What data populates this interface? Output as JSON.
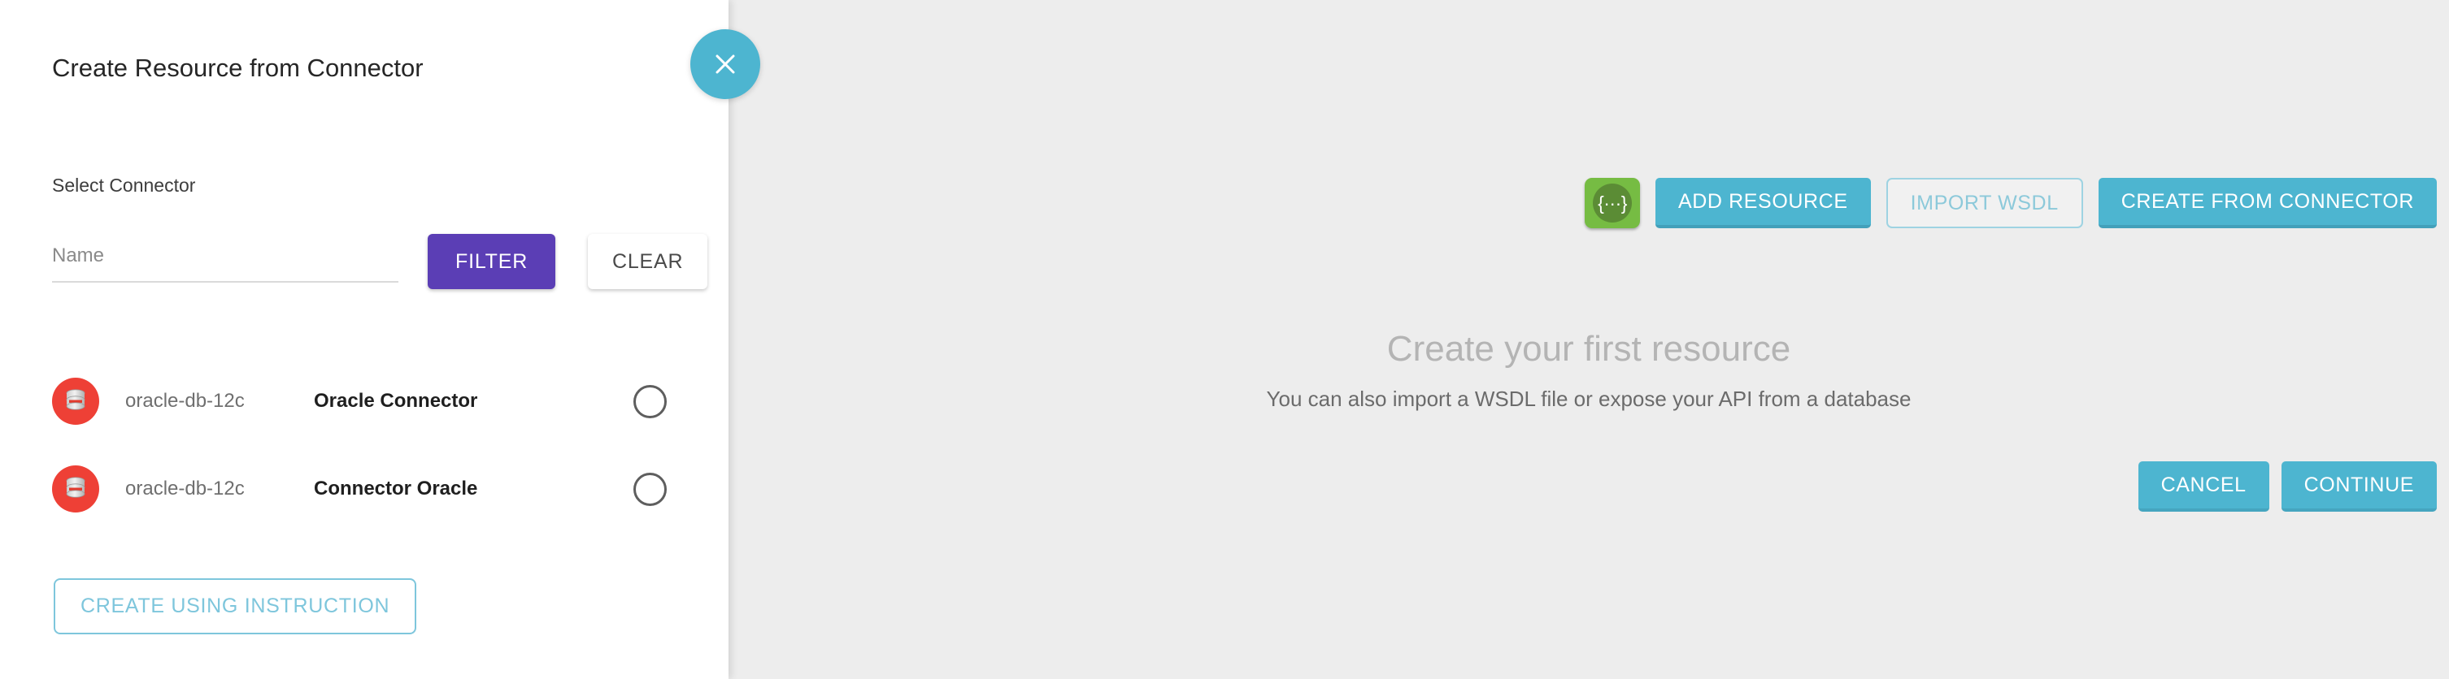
{
  "drawer": {
    "title": "Create Resource from Connector",
    "section_label": "Select Connector",
    "filter": {
      "input_placeholder": "Name",
      "input_value": "",
      "filter_label": "FILTER",
      "clear_label": "CLEAR"
    },
    "connectors": [
      {
        "id": "oracle-db-12c",
        "name": "Oracle Connector",
        "icon": "database-icon",
        "selected": false
      },
      {
        "id": "oracle-db-12c",
        "name": "Connector Oracle",
        "icon": "database-icon",
        "selected": false
      }
    ],
    "instruction_button_label": "CREATE USING INSTRUCTION",
    "close_icon": "close-icon"
  },
  "main": {
    "toolbar": {
      "json_icon": "{···}",
      "add_resource_label": "ADD RESOURCE",
      "import_wsdl_label": "IMPORT WSDL",
      "create_from_connector_label": "CREATE FROM CONNECTOR"
    },
    "empty_state": {
      "title": "Create your first resource",
      "subtitle": "You can also import a WSDL file or expose your API from a database"
    },
    "footer": {
      "cancel_label": "CANCEL",
      "continue_label": "CONTINUE"
    }
  },
  "colors": {
    "teal": "#4db5d0",
    "purple": "#5b3eb5",
    "green": "#76bc43",
    "red": "#ee4036",
    "panel_bg": "#ffffff",
    "main_bg": "#ededed"
  }
}
